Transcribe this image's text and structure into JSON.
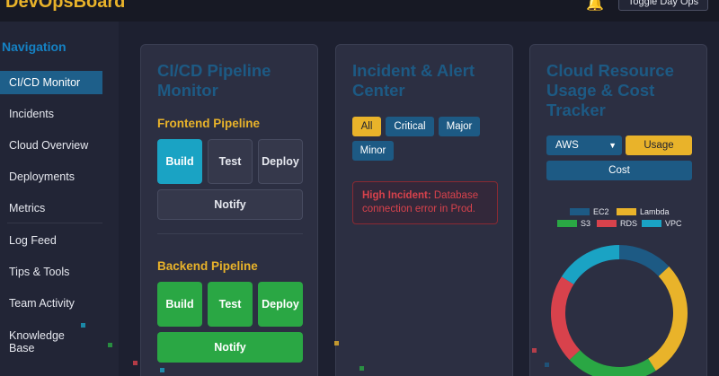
{
  "app": {
    "brand": "DevOpsBoard",
    "toggle_label": "Toggle Day Ops"
  },
  "sidebar": {
    "title": "Navigation",
    "items": [
      {
        "label": "CI/CD Monitor",
        "active": true
      },
      {
        "label": "Incidents"
      },
      {
        "label": "Cloud Overview"
      },
      {
        "label": "Deployments"
      },
      {
        "label": "Metrics"
      },
      {
        "label": "Log Feed"
      },
      {
        "label": "Tips & Tools"
      },
      {
        "label": "Team Activity"
      },
      {
        "label": "Knowledge Base"
      }
    ]
  },
  "pipeline": {
    "title": "CI/CD Pipeline Monitor",
    "frontend": {
      "title": "Frontend Pipeline",
      "build": "Build",
      "test": "Test",
      "deploy": "Deploy",
      "notify": "Notify"
    },
    "backend": {
      "title": "Backend Pipeline",
      "build": "Build",
      "test": "Test",
      "deploy": "Deploy",
      "notify": "Notify"
    }
  },
  "incidents": {
    "title": "Incident & Alert Center",
    "filters": [
      "All",
      "Critical",
      "Major",
      "Minor"
    ],
    "active_filter": "All",
    "alert": {
      "label": "High Incident:",
      "message": "Database connection error in Prod."
    }
  },
  "cloud": {
    "title": "Cloud Resource Usage & Cost Tracker",
    "provider": "AWS",
    "usage_label": "Usage",
    "cost_label": "Cost",
    "legend": [
      {
        "name": "EC2",
        "color": "#1d5a84"
      },
      {
        "name": "Lambda",
        "color": "#e9b32a"
      },
      {
        "name": "S3",
        "color": "#2aa744"
      },
      {
        "name": "RDS",
        "color": "#d8424c"
      },
      {
        "name": "VPC",
        "color": "#1aa3c4"
      }
    ]
  },
  "chart_data": {
    "type": "pie",
    "categories": [
      "EC2",
      "Lambda",
      "S3",
      "RDS",
      "VPC"
    ],
    "values": [
      13,
      28,
      22,
      21,
      16
    ],
    "colors": [
      "#1d5a84",
      "#e9b32a",
      "#2aa744",
      "#d8424c",
      "#1aa3c4"
    ],
    "legend": "top"
  }
}
